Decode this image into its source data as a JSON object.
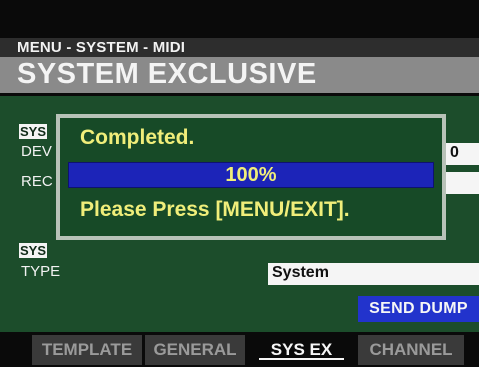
{
  "header": {
    "breadcrumb": "MENU - SYSTEM - MIDI",
    "title": "SYSTEM EXCLUSIVE"
  },
  "panel": {
    "section1_label": "SYS",
    "device_label": "DEV",
    "device_value": "0",
    "receive_label": "REC",
    "section2_label": "SYS",
    "type_label": "TYPE",
    "type_value": "System",
    "send_button_label": "SEND DUMP"
  },
  "dialog": {
    "status_text": "Completed.",
    "progress_text": "100%",
    "progress_fraction": 1.0,
    "message": "Please Press [MENU/EXIT]."
  },
  "tabs": [
    {
      "label": "TEMPLATE",
      "active": false
    },
    {
      "label": "GENERAL",
      "active": false
    },
    {
      "label": "SYS EX",
      "active": true
    },
    {
      "label": "CHANNEL",
      "active": false
    }
  ],
  "colors": {
    "panel_green": "#1c4d2b",
    "dialog_text_yellow": "#f0ee7a",
    "progress_blue": "#1c24b8",
    "button_blue": "#2233cc"
  }
}
